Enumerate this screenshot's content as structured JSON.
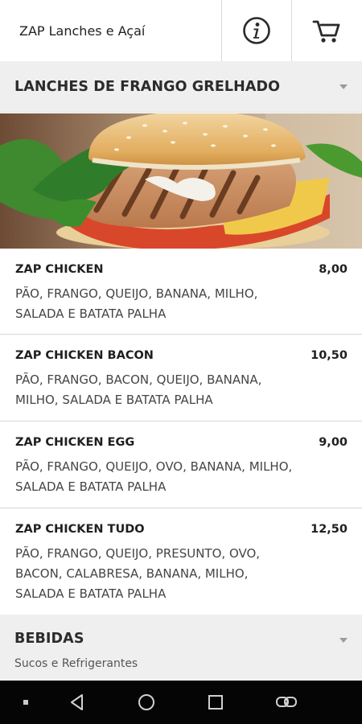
{
  "header": {
    "title": "ZAP Lanches e Açaí",
    "info_icon": "info-icon",
    "cart_icon": "cart-icon"
  },
  "section1": {
    "title": "LANCHES DE FRANGO GRELHADO"
  },
  "items": [
    {
      "name": "ZAP CHICKEN",
      "price": "8,00",
      "desc": "PÃO, FRANGO, QUEIJO, BANANA, MILHO, SALADA E BATATA PALHA"
    },
    {
      "name": "ZAP CHICKEN BACON",
      "price": "10,50",
      "desc": "PÃO, FRANGO, BACON, QUEIJO, BANANA, MILHO, SALADA E BATATA PALHA"
    },
    {
      "name": "ZAP CHICKEN EGG",
      "price": "9,00",
      "desc": "PÃO, FRANGO, QUEIJO, OVO, BANANA, MILHO, SALADA E BATATA PALHA"
    },
    {
      "name": "ZAP CHICKEN TUDO",
      "price": "12,50",
      "desc": "PÃO, FRANGO, QUEIJO, PRESUNTO, OVO, BACON, CALABRESA, BANANA, MILHO, SALADA E BATATA PALHA"
    }
  ],
  "section2": {
    "title": "BEBIDAS",
    "subtitle": "Sucos e Refrigerantes"
  },
  "colors": {
    "header_bg": "#ffffff",
    "section_bg": "#efefef",
    "navbar_bg": "#050505"
  }
}
